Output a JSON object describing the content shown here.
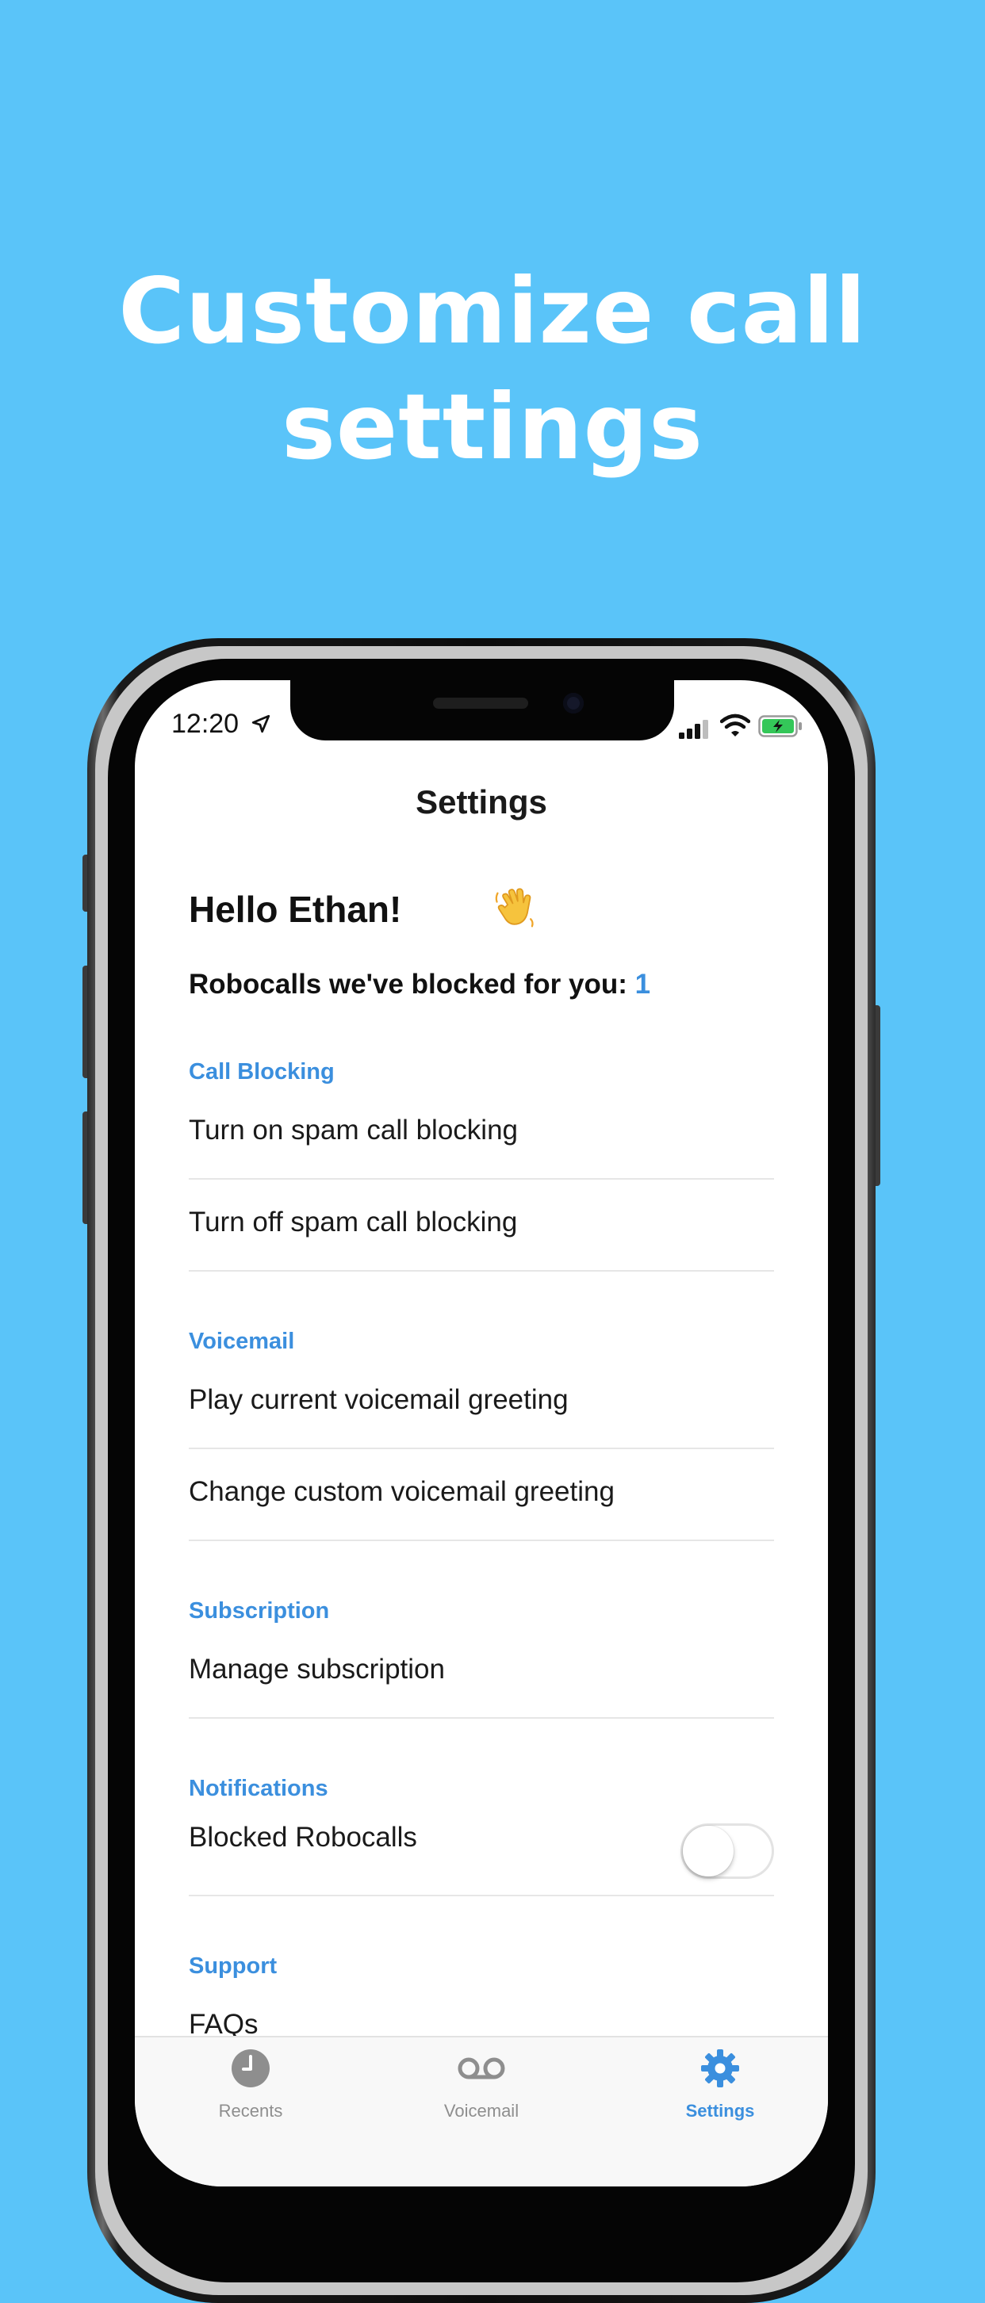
{
  "headline": {
    "line1": "Customize call",
    "line2": "settings"
  },
  "status_bar": {
    "time": "12:20"
  },
  "nav": {
    "title": "Settings"
  },
  "greeting": "Hello Ethan! 👋",
  "greeting_text": "Hello Ethan!",
  "blocked": {
    "label": "Robocalls we've blocked for you:",
    "count": "1"
  },
  "sections": [
    {
      "header": "Call Blocking",
      "rows": [
        "Turn on spam call blocking",
        "Turn off spam call blocking"
      ]
    },
    {
      "header": "Voicemail",
      "rows": [
        "Play current voicemail greeting",
        "Change custom voicemail greeting"
      ]
    },
    {
      "header": "Subscription",
      "rows": [
        "Manage subscription"
      ]
    },
    {
      "header": "Notifications",
      "rows": [
        "Blocked Robocalls"
      ]
    },
    {
      "header": "Support",
      "rows": [
        "FAQs"
      ]
    }
  ],
  "notifications_toggle": {
    "state": "off"
  },
  "tabs": [
    {
      "label": "Recents",
      "icon": "clock-icon",
      "active": false
    },
    {
      "label": "Voicemail",
      "icon": "voicemail-icon",
      "active": false
    },
    {
      "label": "Settings",
      "icon": "gear-icon",
      "active": true
    }
  ],
  "colors": {
    "background": "#5ac4f9",
    "accent": "#3b8fde",
    "text": "#1a1a1a",
    "inactive_tab": "#8e8e8e"
  }
}
